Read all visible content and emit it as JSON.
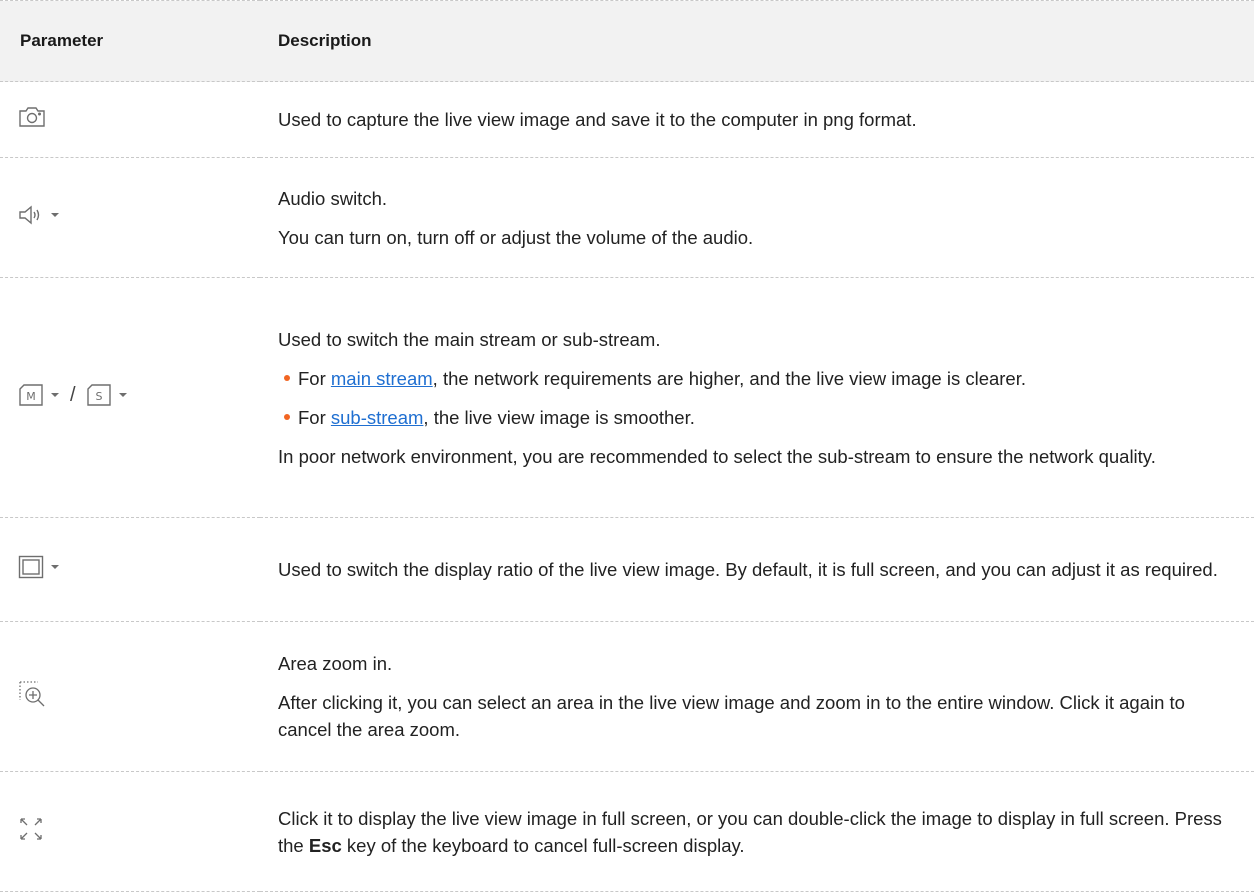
{
  "table": {
    "headers": {
      "parameter": "Parameter",
      "description": "Description"
    },
    "rows": [
      {
        "icon": "camera-icon",
        "lines": [
          "Used to capture the live view image and save it to the computer in png format."
        ]
      },
      {
        "icon": "speaker-icon",
        "lines": [
          "Audio switch.",
          "You can turn on, turn off or adjust the volume of the audio."
        ]
      },
      {
        "icon": "main-stream-icon / sub-stream-icon",
        "separator": "/",
        "intro": "Used to switch the main stream or sub-stream.",
        "bullet1": {
          "prefix": "For ",
          "link": "main stream",
          "suffix": ", the network requirements are higher, and the live view image is clearer."
        },
        "bullet2": {
          "prefix": "For ",
          "link": "sub-stream",
          "suffix": ", the live view image is smoother."
        },
        "outro": "In poor network environment, you are recommended to select the sub-stream to ensure the network quality."
      },
      {
        "icon": "display-ratio-icon",
        "lines": [
          "Used to switch the display ratio of the live view image. By default, it is full screen, and you can adjust it as required."
        ]
      },
      {
        "icon": "area-zoom-icon",
        "lines": [
          "Area zoom in.",
          "After clicking it, you can select an area in the live view image and zoom in to the entire window. Click it again to cancel the area zoom."
        ]
      },
      {
        "icon": "fullscreen-icon",
        "text_before": "Click it to display the live view image in full screen, or you can double-click the image to display in full screen. Press the ",
        "key": "Esc",
        "text_after": " key of the keyboard to cancel full-screen display."
      }
    ]
  },
  "colors": {
    "header_bg": "#f2f2f2",
    "link": "#1f6fd1",
    "bullet": "#f26522",
    "icon": "#6e6e6e",
    "divider": "#c8c8c8"
  }
}
